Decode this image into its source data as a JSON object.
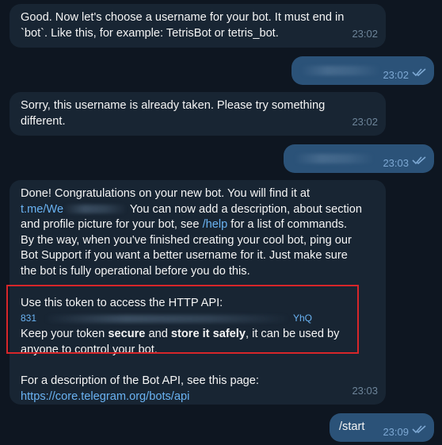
{
  "messages": {
    "m1": {
      "line1": "Good. Now let's choose a username for your bot. It must end in",
      "line2": "`bot`. Like this, for example: TetrisBot or tetris_bot.",
      "time": "23:02"
    },
    "m2": {
      "time": "23:02"
    },
    "m3": {
      "line1": "Sorry, this username is already taken. Please try something",
      "line2": "different.",
      "time": "23:02"
    },
    "m4": {
      "time": "23:03"
    },
    "m5": {
      "l1": "Done! Congratulations on your new bot. You will find it at",
      "l2_link": "t.me/We",
      "l2_rest": " You can now add a description, about section",
      "l3_a": "and profile picture for your bot, see ",
      "l3_link": "/help",
      "l3_b": " for a list of commands.",
      "l4": "By the way, when you've finished creating your cool bot, ping our",
      "l5": "Bot Support if you want a better username for it. Just make sure",
      "l6": "the bot is fully operational before you do this.",
      "t1": "Use this token to access the HTTP API:",
      "t2_start": "831",
      "t2_end": "YhQ",
      "t3_a": "Keep your token ",
      "t3_b": "secure",
      "t3_c": " and ",
      "t3_d": "store it safely",
      "t3_e": ", it can be used by",
      "t4": "anyone to control your bot.",
      "d1": "For a description of the Bot API, see this page:",
      "d2_link": "https://core.telegram.org/bots/api",
      "time": "23:03"
    },
    "m6": {
      "text": "/start",
      "time": "23:09"
    }
  },
  "colors": {
    "background": "#0e1621",
    "incoming_bubble": "#182533",
    "outgoing_bubble": "#2b5278",
    "link": "#6ab3f3",
    "highlight_box": "#d7262a"
  }
}
